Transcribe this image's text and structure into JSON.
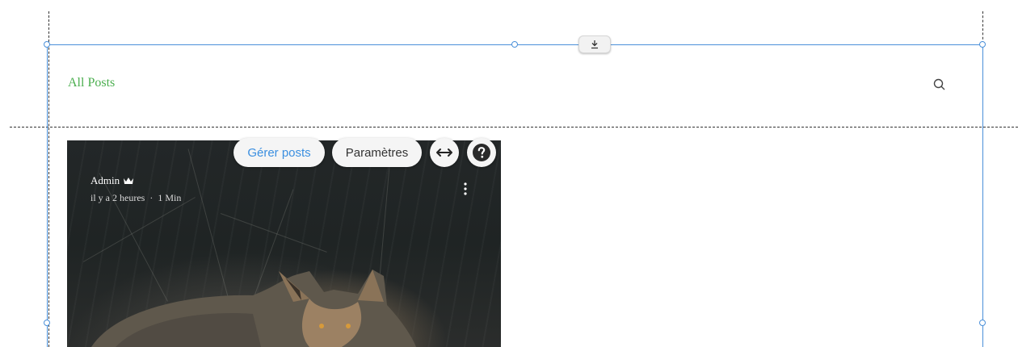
{
  "header": {
    "title": "All Posts"
  },
  "post": {
    "author": "Admin",
    "time": "il y a 2 heures",
    "separator": "·",
    "read_time": "1 Min"
  },
  "toolbar": {
    "manage_label": "Gérer posts",
    "settings_label": "Paramètres",
    "stretch_icon": "horizontal-stretch-icon",
    "help_icon": "help-icon"
  },
  "editor": {
    "anchor_icon": "download-arrow-icon"
  },
  "colors": {
    "accent_green": "#4caf50",
    "selection_blue": "#4a90d9",
    "manage_blue": "#3b8fe0"
  }
}
